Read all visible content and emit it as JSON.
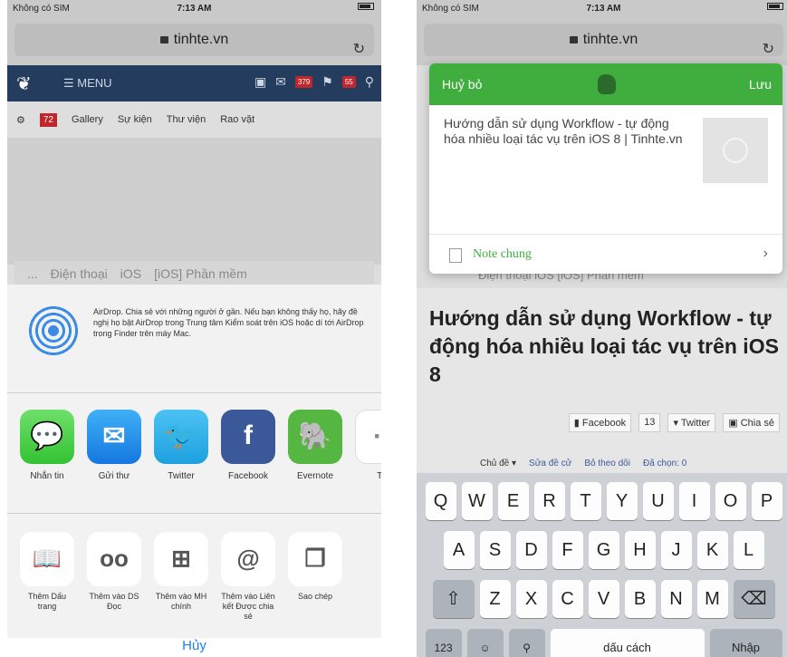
{
  "left": {
    "status": {
      "carrier": "Không có SIM",
      "time": "7:13 AM"
    },
    "url": "tinhte.vn",
    "nav": {
      "menu": "MENU",
      "badge1": "379",
      "badge2": "55"
    },
    "subnav": {
      "count": "72",
      "items": [
        "Gallery",
        "Sự kiện",
        "Thư viện",
        "Rao vặt"
      ]
    },
    "breadcrumb": [
      "...",
      "Điện thoại",
      "iOS",
      "[iOS] Phần mềm"
    ],
    "airdrop_text": "AirDrop. Chia sẻ với những người ở gần. Nếu bạn không thấy họ, hãy đề nghị họ bật AirDrop trong Trung tâm Kiểm soát trên iOS hoặc dí tới AirDrop trong Finder trên máy Mac.",
    "apps": [
      {
        "label": "Nhắn tin",
        "icon": "messages-icon"
      },
      {
        "label": "Gửi thư",
        "icon": "mail-icon"
      },
      {
        "label": "Twitter",
        "icon": "twitter-icon"
      },
      {
        "label": "Facebook",
        "icon": "facebook-icon"
      },
      {
        "label": "Evernote",
        "icon": "evernote-icon"
      },
      {
        "label": "Th",
        "icon": "more-icon"
      }
    ],
    "actions": [
      {
        "label": "Thêm Dấu trang",
        "icon": "bookmark-icon"
      },
      {
        "label": "Thêm vào DS Đọc",
        "icon": "reading-list-icon"
      },
      {
        "label": "Thêm vào MH chính",
        "icon": "add-home-icon"
      },
      {
        "label": "Thêm vào Liên kết Được chia sẻ",
        "icon": "shared-links-icon"
      },
      {
        "label": "Sao chép",
        "icon": "copy-icon"
      }
    ],
    "cancel": "Hủy"
  },
  "right": {
    "status": {
      "carrier": "Không có SIM",
      "time": "7:13 AM"
    },
    "url": "tinhte.vn",
    "evernote": {
      "cancel": "Huỷ bỏ",
      "save": "Lưu",
      "note_text": "Hướng dẫn sử dụng Workflow - tự động hóa nhiều loại tác vụ trên iOS 8 | Tinhte.vn",
      "notebook": "Note chung"
    },
    "breadcrumb": "Điện thoại   iOS   [iOS] Phần mềm",
    "article_title": "Hướng dẫn sử dụng Workflow - tự động hóa nhiều loại tác vụ trên iOS 8",
    "share": {
      "facebook": "Facebook",
      "fb_count": "13",
      "twitter": "Twitter",
      "chiase": "Chia sẻ"
    },
    "meta": [
      "Chủ đề ▾",
      "Sửa đề cử",
      "Bỏ theo dõi",
      "Đã chọn: 0"
    ],
    "keyboard": {
      "row1": [
        "Q",
        "W",
        "E",
        "R",
        "T",
        "Y",
        "U",
        "I",
        "O",
        "P"
      ],
      "row2": [
        "A",
        "S",
        "D",
        "F",
        "G",
        "H",
        "J",
        "K",
        "L"
      ],
      "row3": [
        "Z",
        "X",
        "C",
        "V",
        "B",
        "N",
        "M"
      ],
      "row4": [
        "123",
        "☺",
        "⚲",
        "dấu cách",
        "Nhập"
      ]
    }
  }
}
